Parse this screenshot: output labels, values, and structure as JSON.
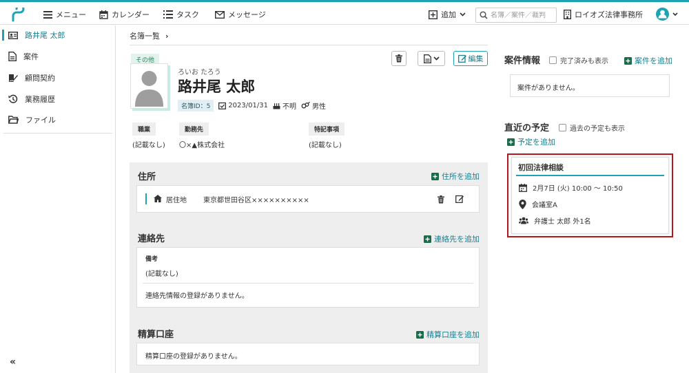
{
  "header": {
    "menu": "メニュー",
    "calendar": "カレンダー",
    "task": "タスク",
    "message": "メッセージ",
    "add": "追加",
    "search_placeholder": "名簿／案件／裁判",
    "office": "ロイオズ法律事務所"
  },
  "sidebar": {
    "items": [
      {
        "label": "路井尾 太郎",
        "icon": "contact-card-icon"
      },
      {
        "label": "案件",
        "icon": "document-icon"
      },
      {
        "label": "顧問契約",
        "icon": "contract-sign-icon"
      },
      {
        "label": "業務履歴",
        "icon": "history-icon"
      },
      {
        "label": "ファイル",
        "icon": "folder-icon"
      }
    ],
    "collapse": "«"
  },
  "breadcrumb": {
    "label": "名簿一覧",
    "sep": "›"
  },
  "profile": {
    "tag": "その他",
    "kana": "ろいお たろう",
    "name": "路井尾 太郎",
    "id_label": "名簿ID：5",
    "date": "2023/01/31",
    "unknown": "不明",
    "gender": "男性",
    "edit": "編集"
  },
  "fields": {
    "occupation_label": "職業",
    "occupation_value": "(記載なし)",
    "employer_label": "勤務先",
    "employer_value": "〇×▲株式会社",
    "notes_label": "特記事項",
    "notes_value": "(記載なし)"
  },
  "address": {
    "title": "住所",
    "add": "住所を追加",
    "type": "居住地",
    "value": "東京都世田谷区××××××××××"
  },
  "contact": {
    "title": "連絡先",
    "add": "連絡先を追加",
    "memo_label": "備考",
    "memo_value": "(記載なし)",
    "empty": "連絡先情報の登録がありません。"
  },
  "account": {
    "title": "精算口座",
    "add": "精算口座を追加",
    "empty": "精算口座の登録がありません。"
  },
  "cases": {
    "title": "案件情報",
    "show_done": "完了済みも表示",
    "add": "案件を追加",
    "empty": "案件がありません。"
  },
  "schedule": {
    "title": "直近の予定",
    "show_past": "過去の予定も表示",
    "add": "予定を追加",
    "event": {
      "title": "初回法律相談",
      "datetime": "2月7日 (火) 10:00 ～ 10:50",
      "place": "会議室A",
      "people": "弁護士 太郎 外1名"
    }
  },
  "colors": {
    "accent": "#1ea3b4",
    "highlight": "#b3161b",
    "add_green": "#1a6b4a"
  }
}
